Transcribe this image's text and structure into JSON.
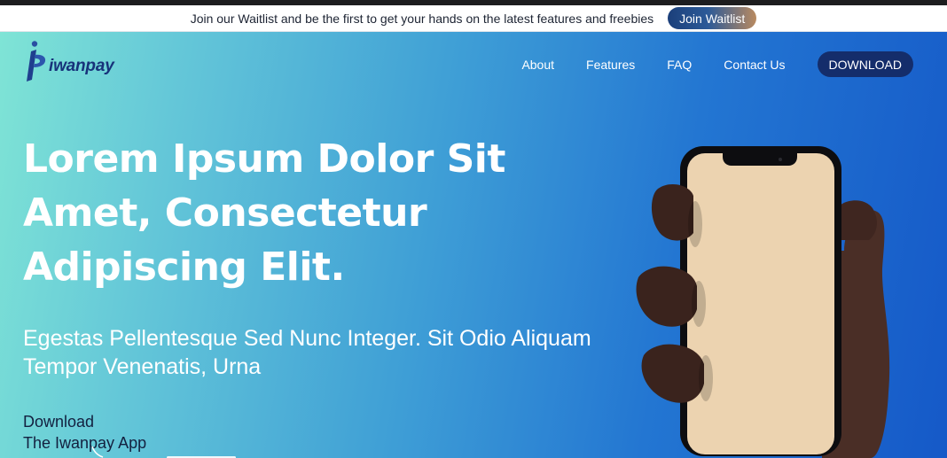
{
  "announcement": {
    "text": "Join our Waitlist and be the first to get your hands on the latest features and freebies",
    "button_label": "Join Waitlist"
  },
  "brand": {
    "name": "iwanpay"
  },
  "nav": {
    "links": [
      "About",
      "Features",
      "FAQ",
      "Contact Us"
    ],
    "download_label": "DOWNLOAD"
  },
  "hero": {
    "headline": "Lorem Ipsum Dolor Sit Amet, Consectetur Adipiscing Elit.",
    "subheadline": "Egestas Pellentesque Sed Nunc Integer. Sit Odio Aliquam Tempor Venenatis, Urna",
    "download_line1": "Download",
    "download_line2": "The Iwanpay App"
  },
  "colors": {
    "hero_gradient_start": "#7fe4d6",
    "hero_gradient_end": "#1559c8",
    "button_dark": "#142d6b",
    "phone_screen": "#ecd3b0",
    "hand": "#4a2e26"
  },
  "icons": {
    "logo": "iwanpay-logo-icon",
    "phone": "phone-in-hand-illustration"
  }
}
